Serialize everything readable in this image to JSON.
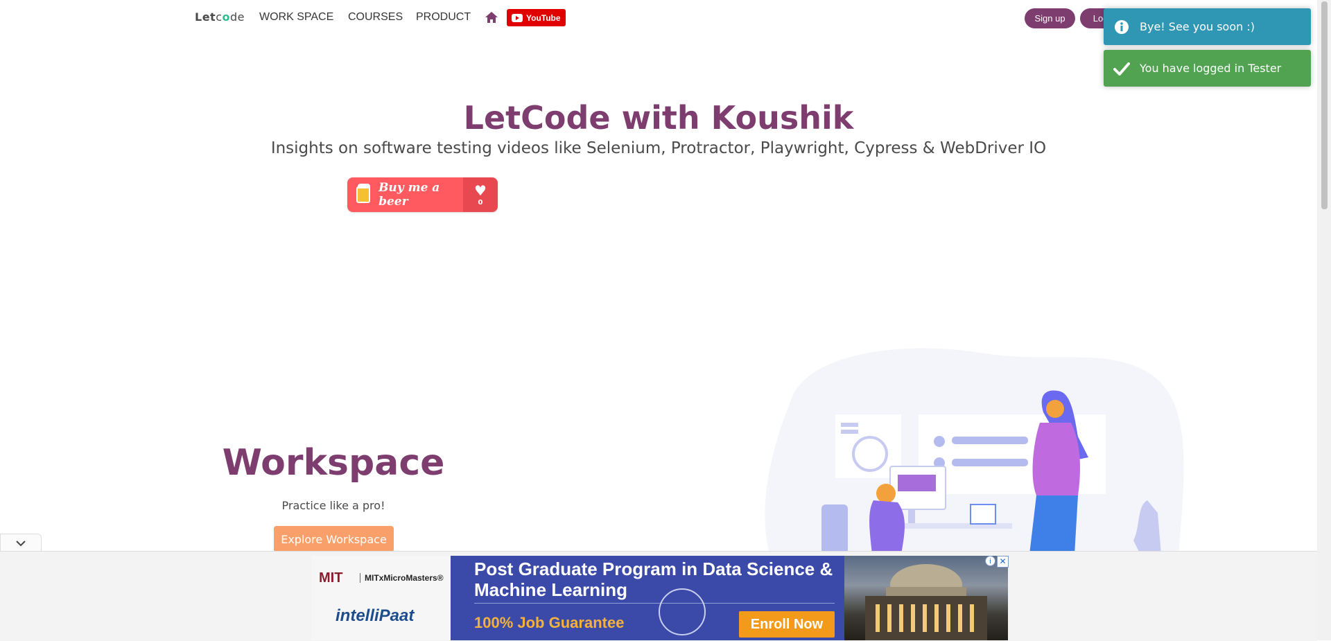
{
  "navbar": {
    "brand_prefix": "Let",
    "brand_c": "c",
    "brand_o": "o",
    "brand_suffix": "de",
    "links": [
      {
        "label": "WORK SPACE"
      },
      {
        "label": "COURSES"
      },
      {
        "label": "PRODUCT"
      }
    ],
    "home_icon": "home-icon",
    "youtube_label": "YouTube",
    "signup_label": "Sign up",
    "login_label": "Log in",
    "accent_color": "#7e3d6f"
  },
  "hero": {
    "title": "LetCode with Koushik",
    "subtitle": "Insights on software testing videos like Selenium, Protractor, Playwright, Cypress & WebDriver IO",
    "beer_label": "Buy me a beer",
    "beer_count": "0"
  },
  "workspace": {
    "title": "Workspace",
    "subtitle": "Practice like a pro!",
    "button_label": "Explore Workspace"
  },
  "toasts": [
    {
      "type": "info",
      "message": "Bye! See you soon :)",
      "color": "#2f96b4"
    },
    {
      "type": "success",
      "message": "You have logged in Tester",
      "color": "#51a351"
    }
  ],
  "ad": {
    "mit_logo": "MIT",
    "mitx_label": "MITxMicroMasters®",
    "partner": "intelliPaat",
    "headline": "Post Graduate Program in Data Science & Machine Learning",
    "guarantee": "100% Job Guarantee",
    "cta": "Enroll Now",
    "info_glyph": "i",
    "close_glyph": "✕"
  }
}
